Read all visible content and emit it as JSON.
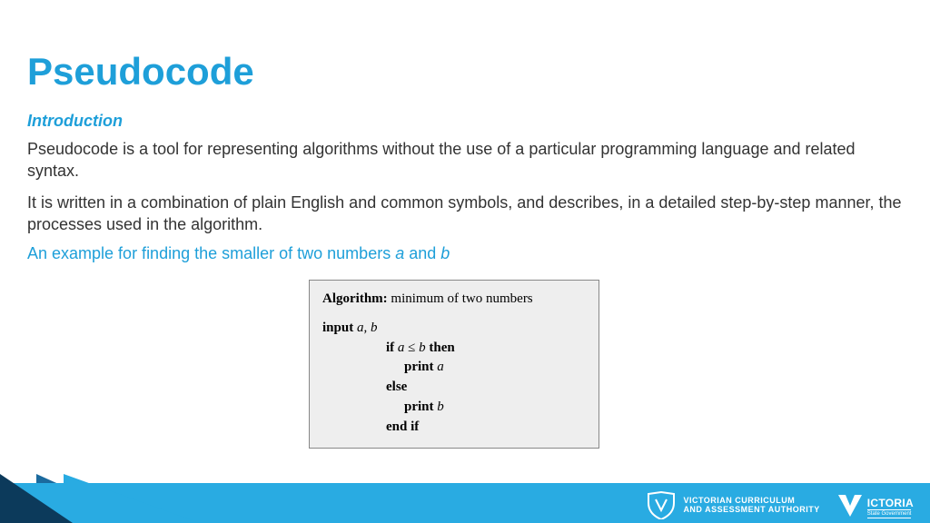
{
  "slide": {
    "title": "Pseudocode",
    "subtitle": "Introduction",
    "paragraph1": "Pseudocode is a tool for representing algorithms without the use of a particular programming language and related syntax.",
    "paragraph2": "It is written in a combination of plain English and common symbols, and describes, in a detailed step-by-step manner, the processes used in the algorithm.",
    "example_prefix": "An example for finding the smaller of two numbers ",
    "example_var_a": "a",
    "example_and": " and ",
    "example_var_b": "b"
  },
  "algorithm": {
    "label": "Algorithm:",
    "name": " minimum of two numbers",
    "input_kw": "input ",
    "input_vars_a": "a",
    "input_comma": ", ",
    "input_vars_b": "b",
    "if_kw": "if ",
    "cond_a": "a",
    "cond_op": " ≤ ",
    "cond_b": "b",
    "then_kw": " then",
    "print_a_kw": "print ",
    "print_a_var": "a",
    "else_kw": "else",
    "print_b_kw": "print ",
    "print_b_var": "b",
    "endif_kw": "end if"
  },
  "footer": {
    "vcaa_line1": "VICTORIAN CURRICULUM",
    "vcaa_line2": "AND ASSESSMENT AUTHORITY",
    "vic_text": "ICTORIA",
    "vic_sub": "State Government"
  }
}
